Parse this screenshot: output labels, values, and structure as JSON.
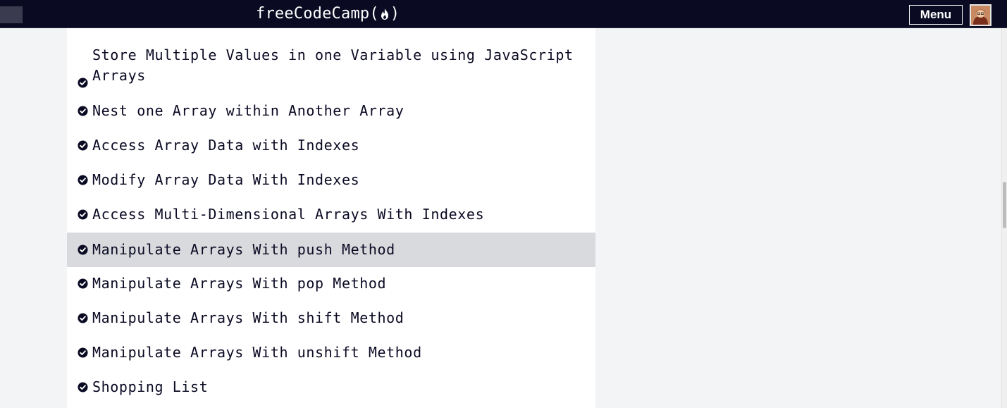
{
  "header": {
    "brand_name": "freeCodeCamp",
    "brand_open": "(",
    "brand_close": ")",
    "menu_label": "Menu"
  },
  "challenges": [
    {
      "label": "Store Multiple Values in one Variable using JavaScript Arrays",
      "completed": true
    },
    {
      "label": "Nest one Array within Another Array",
      "completed": true
    },
    {
      "label": "Access Array Data with Indexes",
      "completed": true
    },
    {
      "label": "Modify Array Data With Indexes",
      "completed": true
    },
    {
      "label": "Access Multi-Dimensional Arrays With Indexes",
      "completed": true
    },
    {
      "label": "Manipulate Arrays With push Method",
      "completed": true,
      "highlighted": true
    },
    {
      "label": "Manipulate Arrays With pop Method",
      "completed": true
    },
    {
      "label": "Manipulate Arrays With shift Method",
      "completed": true
    },
    {
      "label": "Manipulate Arrays With unshift Method",
      "completed": true
    },
    {
      "label": "Shopping List",
      "completed": true
    }
  ],
  "colors": {
    "navbar": "#0a0a23",
    "highlight_row": "#d9dade",
    "text": "#0a0a23",
    "page_bg": "#f3f4f6"
  },
  "icons": {
    "completed": "check-circle-icon",
    "brand": "flame-icon",
    "avatar": "user-avatar"
  }
}
